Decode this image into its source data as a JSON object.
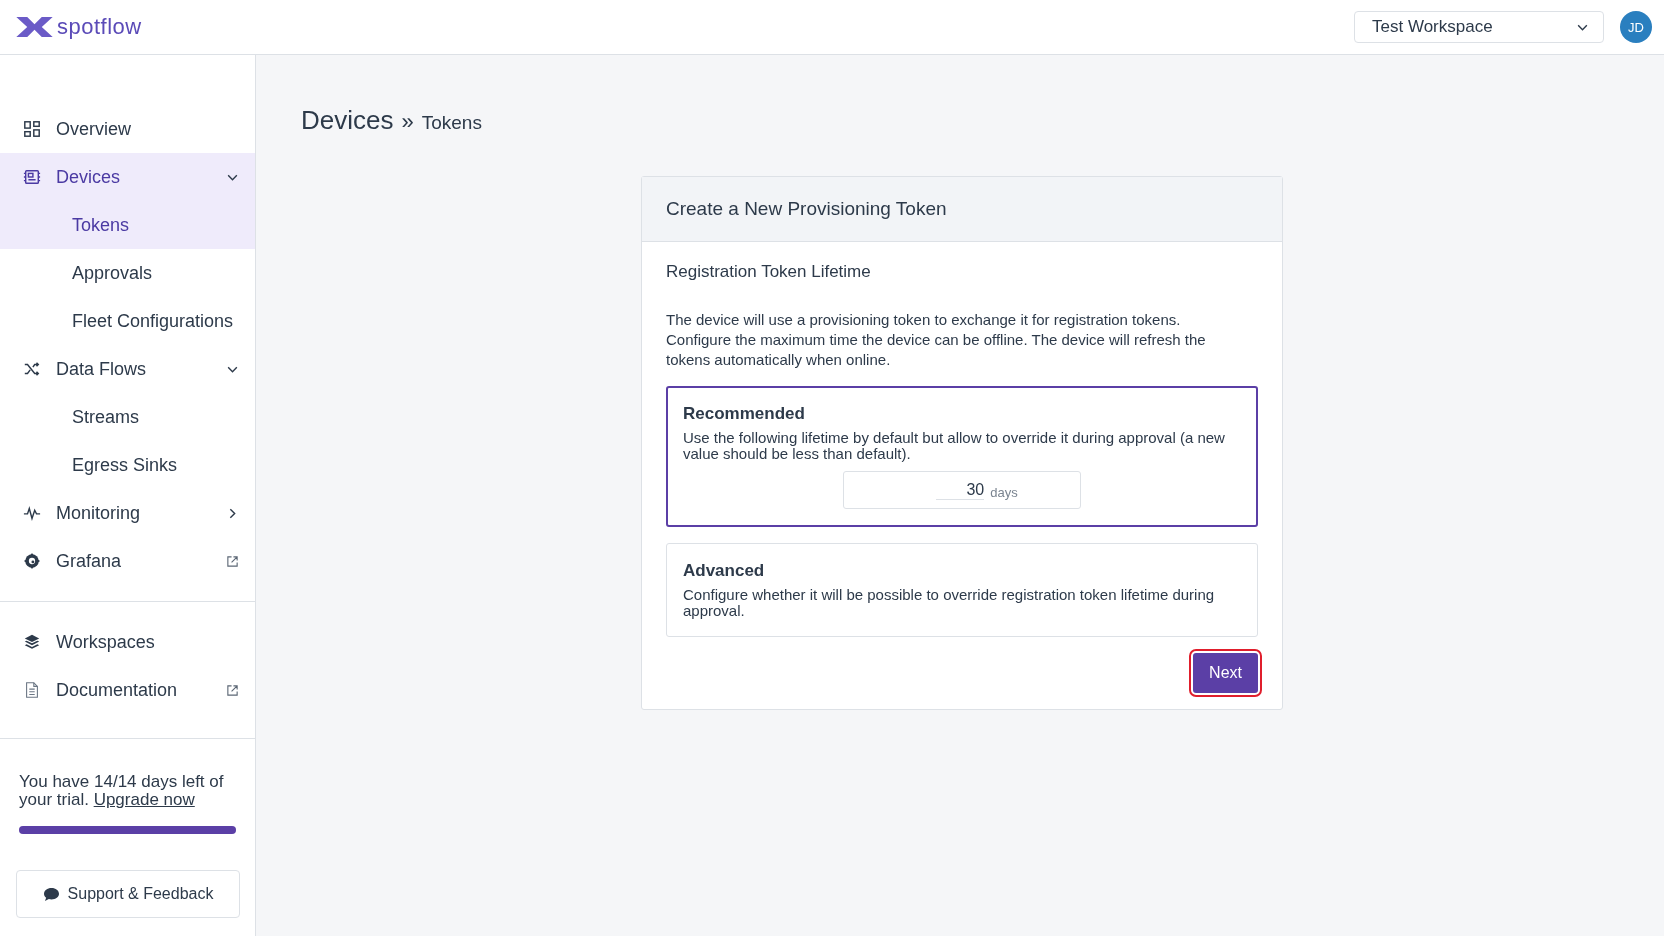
{
  "header": {
    "logo": "spotflow",
    "workspace": "Test Workspace",
    "avatar": "JD"
  },
  "nav": [
    {
      "label": "Overview",
      "kind": "link",
      "selected": false
    },
    {
      "label": "Devices",
      "kind": "group",
      "selected": true,
      "expanded": true,
      "children": [
        {
          "label": "Tokens",
          "selected": true
        },
        {
          "label": "Approvals",
          "selected": false
        },
        {
          "label": "Fleet Configurations",
          "selected": false
        }
      ]
    },
    {
      "label": "Data Flows",
      "kind": "group",
      "selected": false,
      "expanded": true,
      "children": [
        {
          "label": "Streams",
          "selected": false
        },
        {
          "label": "Egress Sinks",
          "selected": false
        }
      ]
    },
    {
      "label": "Monitoring",
      "kind": "group",
      "selected": false,
      "expanded": false
    },
    {
      "label": "Grafana",
      "kind": "external",
      "selected": false
    }
  ],
  "nav_secondary": [
    {
      "label": "Workspaces",
      "kind": "link",
      "selected": false
    },
    {
      "label": "Documentation",
      "kind": "external",
      "selected": false
    }
  ],
  "trial": {
    "text": "You have 14/14 days left of your trial.",
    "link": "Upgrade now",
    "level": 1
  },
  "support_button": "Support & Feedback",
  "breadcrumb": [
    "Devices",
    "»",
    "Tokens"
  ],
  "card": {
    "title": "Create a New Provisioning Token",
    "section": "Registration Token Lifetime",
    "description": "The device will use a provisioning token to exchange it for registration tokens. Configure the maximum time the device can be offline. The device will refresh the tokens automatically when online.",
    "options": [
      {
        "title": "Recommended",
        "description": "Use the following lifetime by default but allow to override it during approval (a new value should be less than default).",
        "selected": true,
        "value": "30",
        "unit": "days"
      },
      {
        "title": "Advanced",
        "description": "Configure whether it will be possible to override registration token lifetime during approval.",
        "selected": false
      }
    ],
    "next_button": {
      "label": "Next",
      "focused": true
    }
  }
}
